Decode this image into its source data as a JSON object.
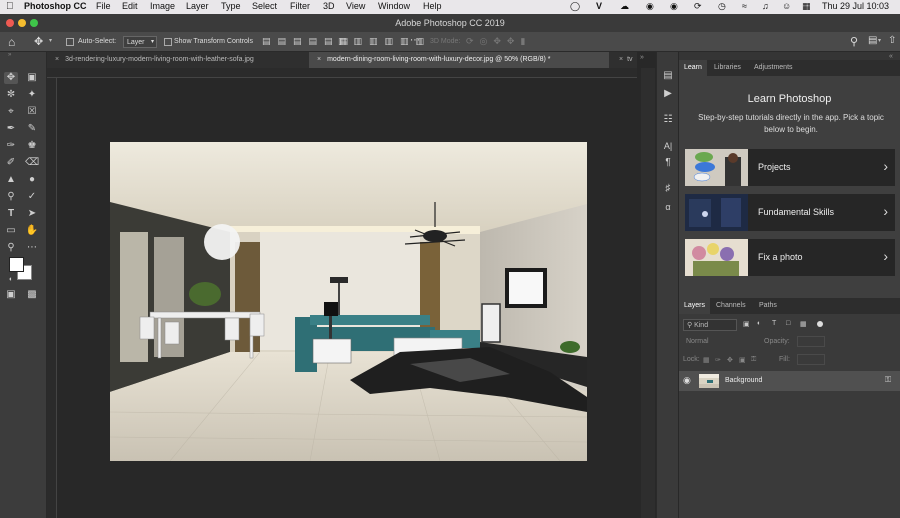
{
  "menubar": {
    "app_name": "Photoshop CC",
    "menus": [
      "File",
      "Edit",
      "Image",
      "Layer",
      "Type",
      "Select",
      "Filter",
      "3D",
      "View",
      "Window",
      "Help"
    ],
    "datetime": "Thu 29 Jul  10:03"
  },
  "appbar": {
    "title": "Adobe Photoshop CC 2019"
  },
  "options": {
    "auto_select_label": "Auto-Select:",
    "auto_select_value": "Layer",
    "show_transform_label": "Show Transform Controls",
    "mode_3d_label": "3D Mode:"
  },
  "tabs": [
    {
      "label": "3d-rendering-luxury-modern-living-room-with-leather-sofa.jpg"
    },
    {
      "label": "modern-dining-room-living-room-with-luxury-decor.jpg @ 50% (RGB/8) *"
    },
    {
      "label": "tv"
    }
  ],
  "panels": {
    "top_tabs": [
      "Learn",
      "Libraries",
      "Adjustments"
    ],
    "learn": {
      "title": "Learn Photoshop",
      "subtitle": "Step-by-step tutorials directly in the app. Pick a topic below to begin.",
      "cards": [
        {
          "label": "Projects"
        },
        {
          "label": "Fundamental Skills"
        },
        {
          "label": "Fix a photo"
        }
      ]
    },
    "layer_tabs": [
      "Layers",
      "Channels",
      "Paths"
    ],
    "layers": {
      "kind_label": "Kind",
      "blend_mode": "Normal",
      "opacity_label": "Opacity:",
      "lock_label": "Lock:",
      "fill_label": "Fill:",
      "items": [
        {
          "name": "Background"
        }
      ]
    }
  },
  "colors": {
    "accent": "#2f6fd6",
    "panel_bg": "#353535",
    "canvas_bg": "#282828",
    "menubar_bg": "#e9e7ea"
  }
}
